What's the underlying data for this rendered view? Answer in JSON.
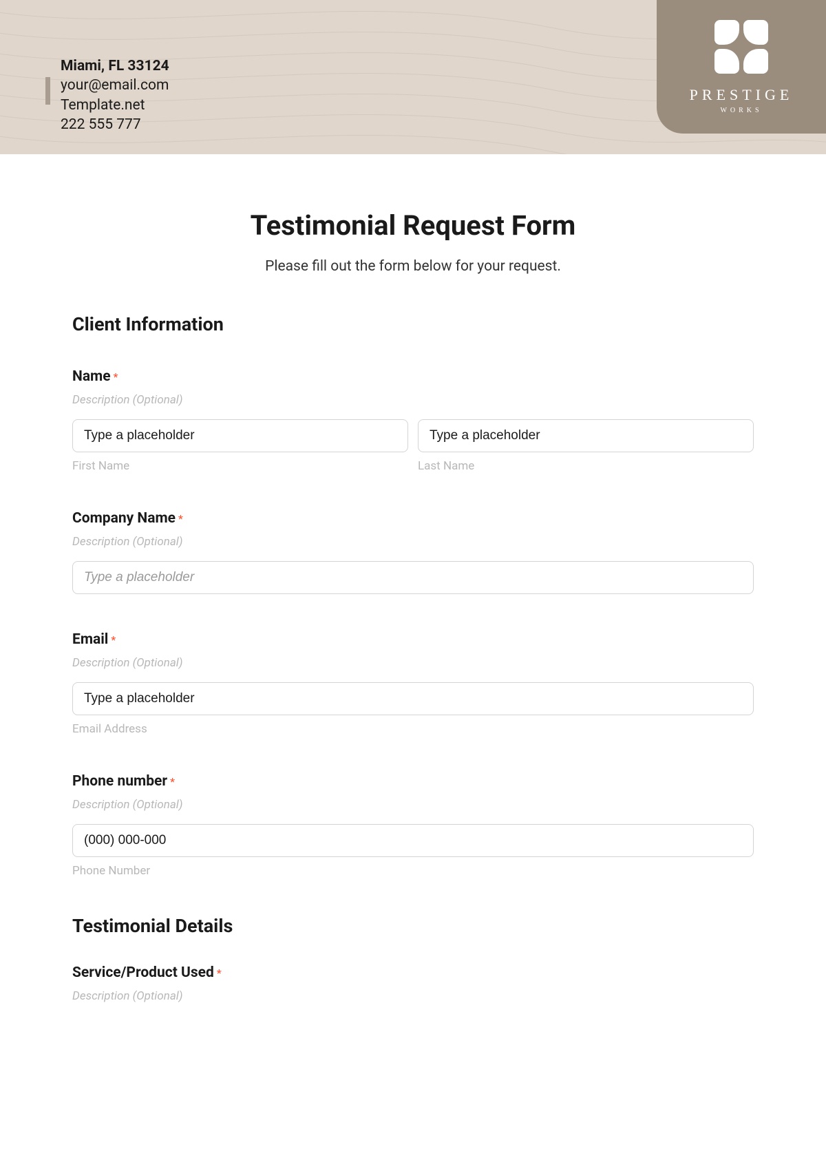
{
  "header": {
    "address": "Miami, FL 33124",
    "email": "your@email.com",
    "website": "Template.net",
    "phone": "222 555 777",
    "brand_name": "PRESTIGE",
    "brand_sub": "WORKS"
  },
  "form": {
    "title": "Testimonial Request Form",
    "subtitle": "Please fill out the form below for your request.",
    "section_client": "Client Information",
    "section_testimonial": "Testimonial Details",
    "desc_placeholder": "Description (Optional)",
    "generic_placeholder": "Type a placeholder",
    "required_mark": "*",
    "fields": {
      "name": {
        "label": "Name",
        "first_sublabel": "First Name",
        "last_sublabel": "Last Name"
      },
      "company": {
        "label": "Company Name"
      },
      "email": {
        "label": "Email",
        "sublabel": "Email Address"
      },
      "phone": {
        "label": "Phone number",
        "placeholder": "(000) 000-000",
        "sublabel": "Phone Number"
      },
      "service": {
        "label": "Service/Product Used"
      }
    }
  }
}
